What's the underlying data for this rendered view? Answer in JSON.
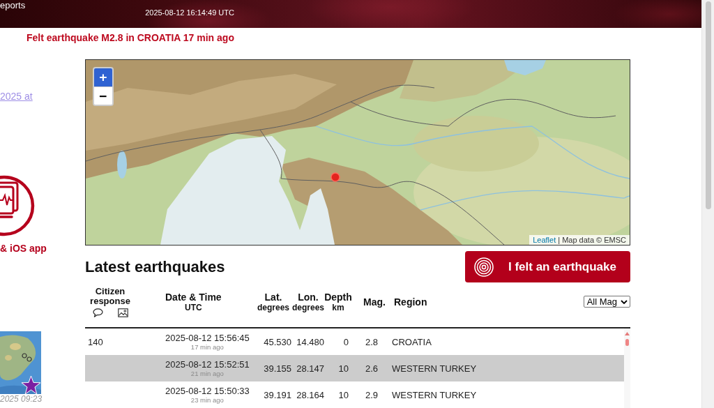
{
  "header": {
    "menu_item": "eports",
    "clock": "2025-08-12 16:14:49 UTC"
  },
  "alert": "Felt earthquake M2.8 in CROATIA 17 min ago",
  "sidebar": {
    "link": "2025 at",
    "app_label": "& iOS app",
    "thumbnail_caption": "2025 09:23"
  },
  "map": {
    "zoom_buttons": [
      {
        "label": "+",
        "highlighted": true
      },
      {
        "label": "−",
        "highlighted": false
      }
    ],
    "attribution_link": "Leaflet",
    "attribution": "| Map data © EMSC"
  },
  "section_title": "Latest earthquakes",
  "felt_button": "I felt an earthquake",
  "table": {
    "columns": [
      {
        "kind": "citizen",
        "label": "Citizen response"
      },
      {
        "kind": "plain",
        "label": "Date & Time",
        "unit": "UTC"
      },
      {
        "kind": "plain",
        "label": "Lat.",
        "unit": "degrees"
      },
      {
        "kind": "plain",
        "label": "Lon.",
        "unit": "degrees"
      },
      {
        "kind": "plain",
        "label": "Depth",
        "unit": "km"
      },
      {
        "kind": "plain",
        "label": "Mag."
      },
      {
        "kind": "plain",
        "label": "Region"
      }
    ],
    "filter": "All Mag",
    "rows": [
      {
        "citizen_count": "140",
        "date": "2025-08-12 15:56:45",
        "ago": "17 min ago",
        "lat": "45.530",
        "lon": "14.480",
        "depth": "0",
        "mag": "2.8",
        "region": "CROATIA",
        "highlighted": false
      },
      {
        "date": "2025-08-12 15:52:51",
        "ago": "21 min ago",
        "lat": "39.155",
        "lon": "28.147",
        "depth": "10",
        "mag": "2.6",
        "region": "WESTERN TURKEY",
        "highlighted": true
      },
      {
        "date": "2025-08-12 15:50:33",
        "ago": "23 min ago",
        "lat": "39.191",
        "lon": "28.164",
        "depth": "10",
        "mag": "2.9",
        "region": "WESTERN TURKEY",
        "highlighted": false
      }
    ]
  }
}
